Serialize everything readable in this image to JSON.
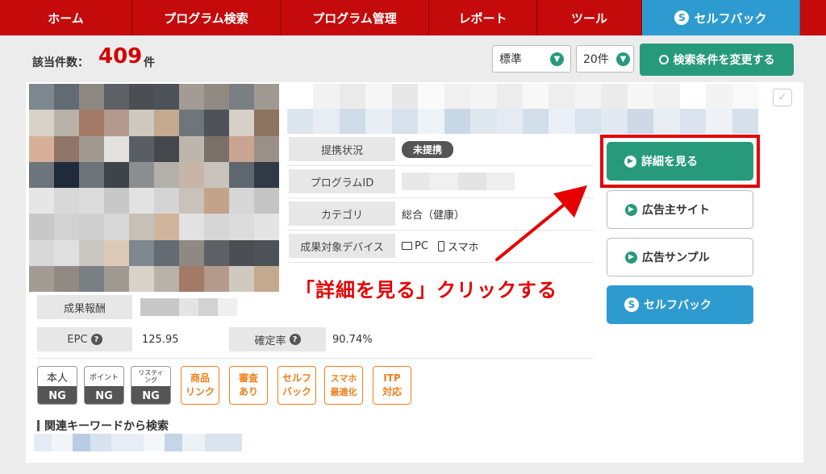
{
  "nav": {
    "items": [
      "ホーム",
      "プログラム検索",
      "プログラム管理",
      "レポート",
      "ツール"
    ],
    "selfback": "セルフバック",
    "selfback_icon": "s-coin-icon"
  },
  "results": {
    "label": "該当件数：",
    "count": "409",
    "unit": "件"
  },
  "controls": {
    "sort_selected": "標準",
    "per_page_selected": "20件",
    "search_button": "検索条件を変更する"
  },
  "program": {
    "rows": [
      {
        "label": "提携状況",
        "value": "未提携"
      },
      {
        "label": "プログラムID",
        "value": ""
      },
      {
        "label": "カテゴリ",
        "value": "総合（健康）"
      },
      {
        "label": "成果対象デバイス",
        "pc": "PC",
        "sp": "スマホ"
      }
    ],
    "reward_label": "成果報酬",
    "epc_label": "EPC",
    "epc_value": "125.95",
    "rate_label": "確定率",
    "rate_value": "90.74%"
  },
  "badges": {
    "ng": [
      {
        "top": "本人",
        "bottom": "NG"
      },
      {
        "top": "ポイント",
        "bottom": "NG"
      },
      {
        "top": "リスティ\nング",
        "bottom": "NG"
      }
    ],
    "orange": [
      "商品\nリンク",
      "審査\nあり",
      "セルフ\nバック",
      "スマホ\n最適化",
      "ITP\n対応"
    ]
  },
  "keywords": {
    "title": "関連キーワードから検索"
  },
  "side_buttons": {
    "detail": "詳細を見る",
    "advertiser_site": "広告主サイト",
    "ad_sample": "広告サンプル",
    "selfback": "セルフバック"
  },
  "annotation": {
    "text": "「詳細を見る」クリックする",
    "color": "#e60000"
  },
  "colors": {
    "nav_red": "#c40a0a",
    "accent_green": "#279a7c",
    "selfback_blue": "#2e9bd0",
    "count_red": "#d40000",
    "badge_orange": "#ef7f1a"
  }
}
